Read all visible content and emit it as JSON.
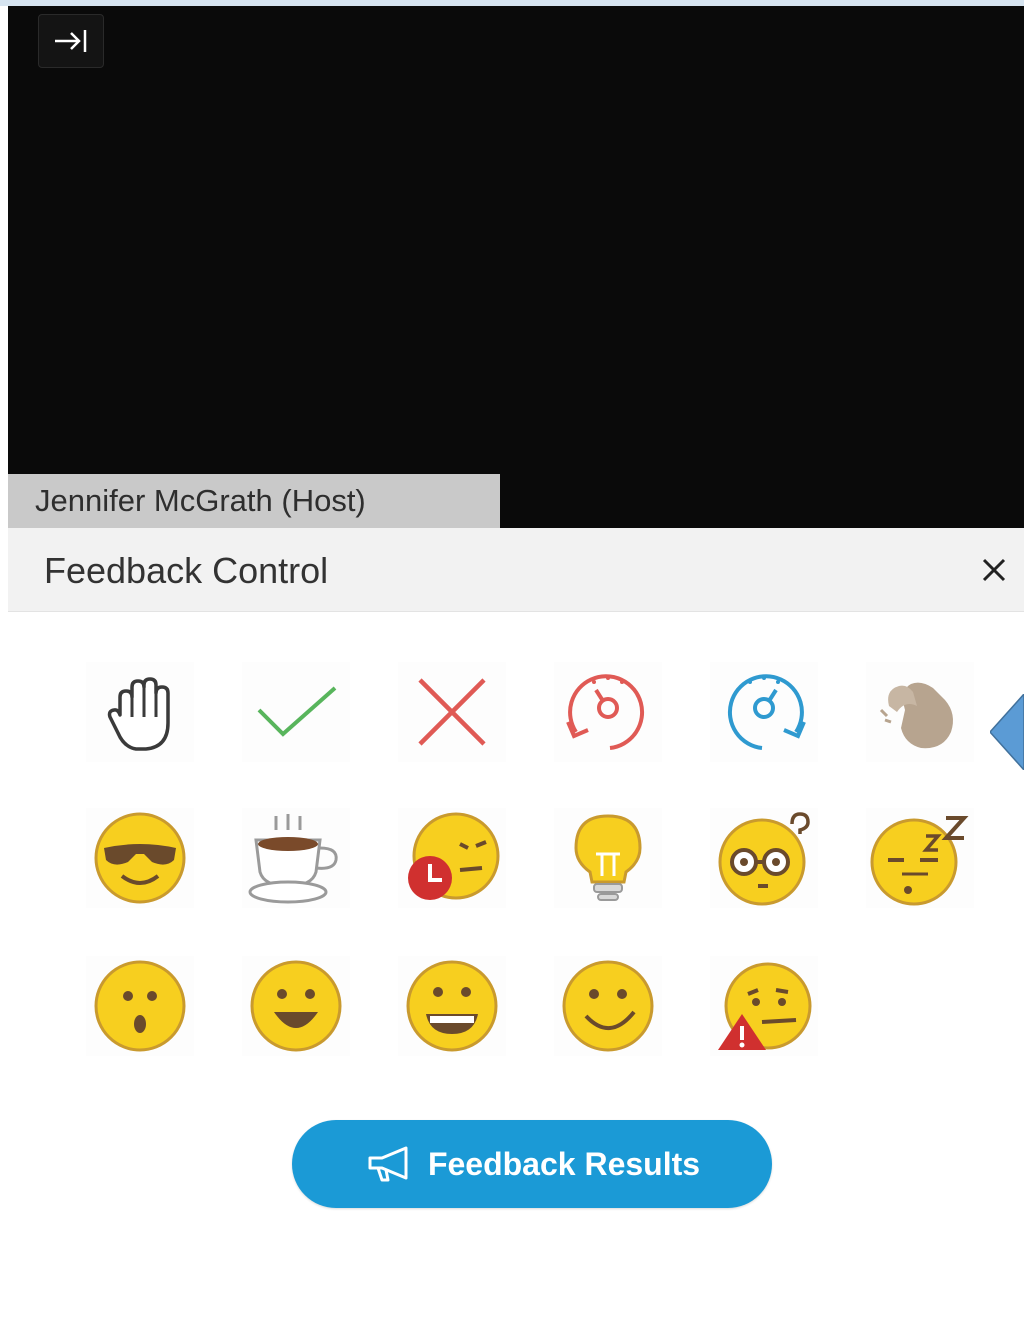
{
  "video": {
    "host_label": "Jennifer McGrath (Host)",
    "exit_icon": "exit-fullscreen-icon"
  },
  "panel": {
    "title": "Feedback Control",
    "close_icon": "close-icon"
  },
  "feedback_icons": {
    "row1": [
      "raise-hand-icon",
      "yes-check-icon",
      "no-x-icon",
      "go-slower-icon",
      "go-faster-icon",
      "applause-icon"
    ],
    "row2": [
      "cool-icon",
      "coffee-break-icon",
      "running-late-icon",
      "idea-icon",
      "confused-icon",
      "sleepy-icon"
    ],
    "row3": [
      "surprised-icon",
      "happy-icon",
      "grinning-icon",
      "smile-icon",
      "warning-face-icon"
    ]
  },
  "results_button": {
    "label": "Feedback Results",
    "icon": "megaphone-icon"
  },
  "colors": {
    "accent": "#1b9ad6",
    "emoji_yellow": "#f7cf1f",
    "emoji_outline": "#c99a2e",
    "red": "#e05a55",
    "blue": "#2f9ad0",
    "green": "#58b55c",
    "callout": "#5b9bd5"
  }
}
